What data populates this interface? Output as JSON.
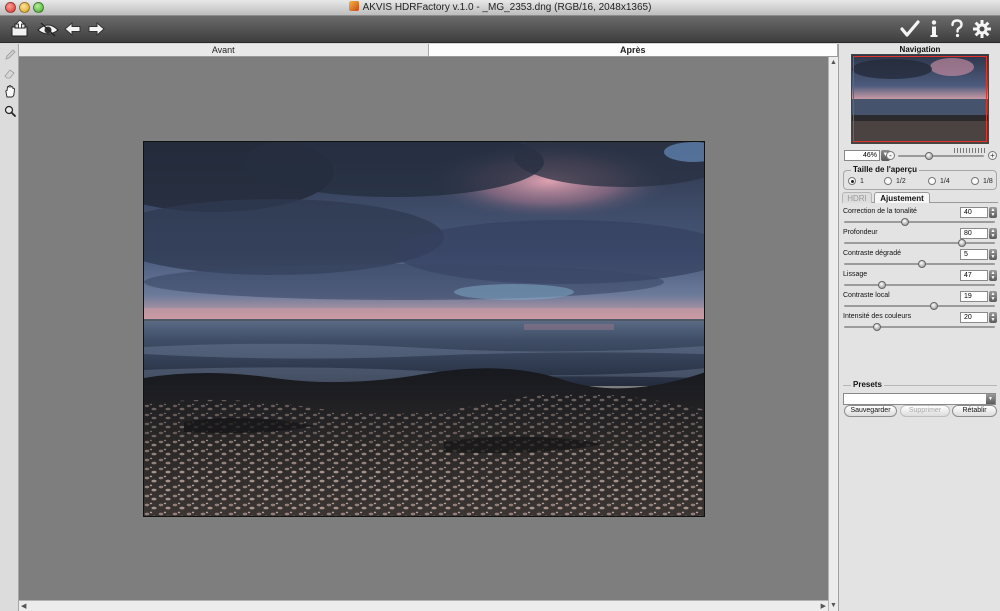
{
  "window": {
    "title": "AKVIS HDRFactory v.1.0 - _MG_2353.dng (RGB/16, 2048x1365)"
  },
  "toolbar": {
    "left_icons": [
      "open-icon",
      "eye-icon",
      "arrow-left-icon",
      "arrow-right-icon"
    ],
    "right_icons": [
      "checkmark-icon",
      "info-icon",
      "help-icon",
      "gear-icon"
    ]
  },
  "tools": [
    "pencil-icon",
    "eraser-icon",
    "hand-icon",
    "zoom-icon"
  ],
  "view_tabs": {
    "before": "Avant",
    "after": "Après",
    "active": "after"
  },
  "navigation": {
    "title": "Navigation",
    "zoom": "46%"
  },
  "preview_size": {
    "title": "Taille de l'aperçu",
    "options": [
      "1",
      "1/2",
      "1/4",
      "1/8"
    ],
    "selected": "1"
  },
  "panel_tabs": {
    "hdri": "HDRI",
    "adjust": "Ajustement",
    "active": "adjust"
  },
  "params": [
    {
      "label": "Correction de la tonalité",
      "value": "40",
      "level": 0.4
    },
    {
      "label": "Profondeur",
      "value": "80",
      "level": 0.8
    },
    {
      "label": "Contraste dégradé",
      "value": "5",
      "level": 0.52
    },
    {
      "label": "Lissage",
      "value": "47",
      "level": 0.24
    },
    {
      "label": "Contraste local",
      "value": "19",
      "level": 0.6
    },
    {
      "label": "Intensité des couleurs",
      "value": "20",
      "level": 0.2
    }
  ],
  "presets": {
    "title": "Presets",
    "selected": "",
    "save": "Sauvegarder",
    "delete": "Supprimer",
    "reset": "Rétablir"
  }
}
